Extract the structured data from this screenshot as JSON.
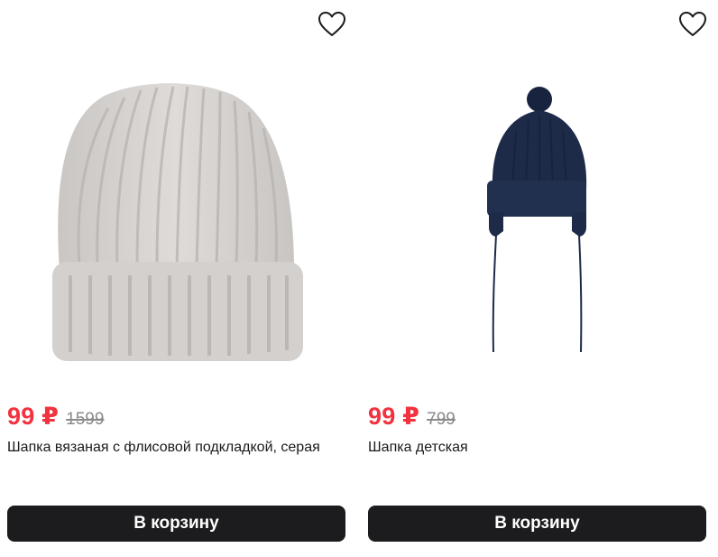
{
  "products": [
    {
      "price": "99 ₽",
      "old_price": "1599",
      "title": "Шапка вязаная с флисовой подкладкой, серая",
      "cart_label": "В корзину",
      "favorite_icon": "heart-outline-icon",
      "image_color": "#d9d6d4"
    },
    {
      "price": "99 ₽",
      "old_price": "799",
      "title": "Шапка детская",
      "cart_label": "В корзину",
      "favorite_icon": "heart-outline-icon",
      "image_color": "#1d2b48"
    }
  ],
  "colors": {
    "price": "#f2323f",
    "old_price": "#8a8a8a",
    "button_bg": "#1c1c1e",
    "button_text": "#ffffff"
  }
}
